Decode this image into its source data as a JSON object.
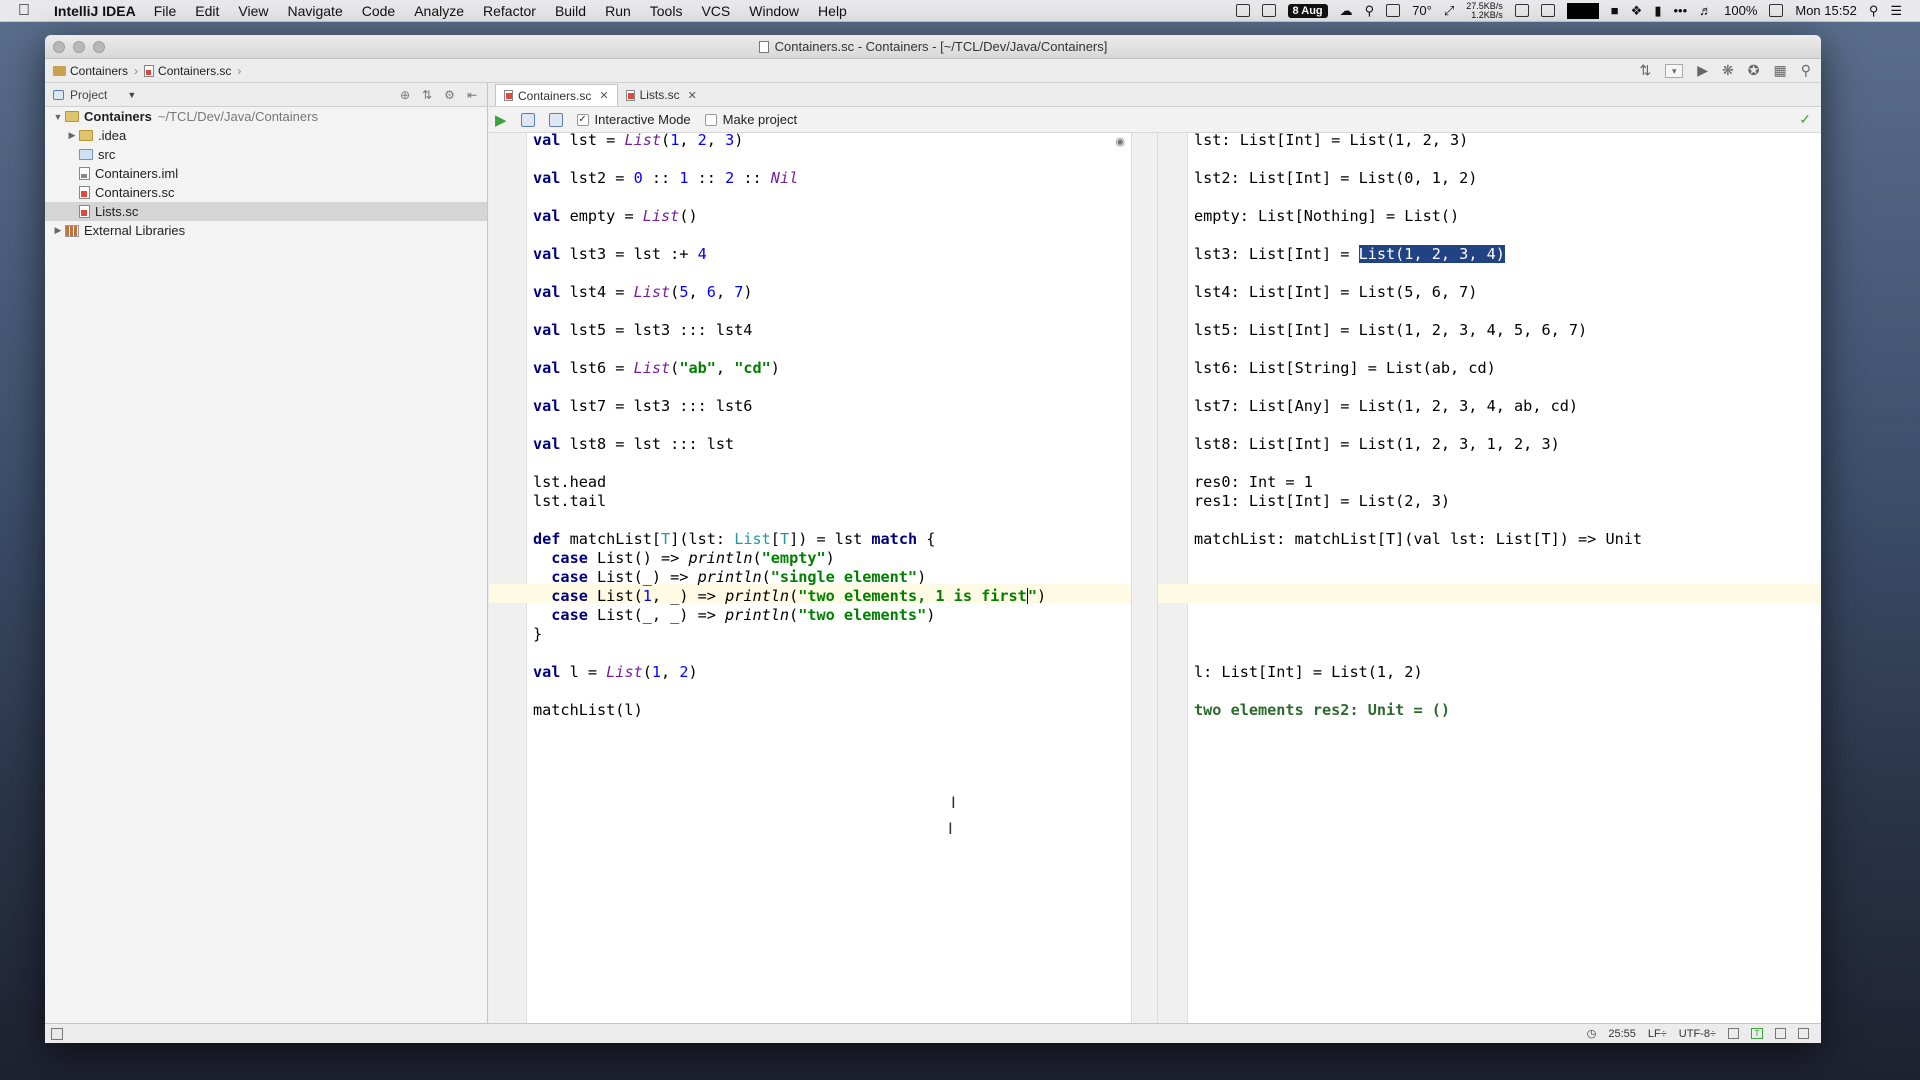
{
  "menubar": {
    "app_name": "IntelliJ IDEA",
    "menus": [
      "File",
      "Edit",
      "View",
      "Navigate",
      "Code",
      "Analyze",
      "Refactor",
      "Build",
      "Run",
      "Tools",
      "VCS",
      "Window",
      "Help"
    ],
    "date_badge": "8 Aug",
    "temperature": "70°",
    "net_up": "27.5KB/s",
    "net_down": "1.2KB/s",
    "battery": "100%",
    "clock": "Mon 15:52"
  },
  "window": {
    "title": "Containers.sc - Containers - [~/TCL/Dev/Java/Containers]"
  },
  "breadcrumb": {
    "project": "Containers",
    "file": "Containers.sc"
  },
  "project_pane": {
    "header": "Project",
    "tree": {
      "root_name": "Containers",
      "root_path": "~/TCL/Dev/Java/Containers",
      "items": [
        ".idea",
        "src",
        "Containers.iml",
        "Containers.sc",
        "Lists.sc"
      ],
      "external": "External Libraries"
    }
  },
  "tabs": [
    {
      "label": "Containers.sc",
      "active": true
    },
    {
      "label": "Lists.sc",
      "active": false
    }
  ],
  "worksheet_toolbar": {
    "interactive_mode": "Interactive Mode",
    "make_project": "Make project"
  },
  "code": {
    "l1_val": "val",
    "l1_name": " lst = ",
    "l1_ty": "List",
    "l1_args_open": "(",
    "l1_n1": "1",
    "l1_sep1": ", ",
    "l1_n2": "2",
    "l1_sep2": ", ",
    "l1_n3": "3",
    "l1_close": ")",
    "l2_val": "val",
    "l2_rest_a": " lst2 = ",
    "l2_n0": "0",
    "l2_op1": " :: ",
    "l2_n1": "1",
    "l2_op2": " :: ",
    "l2_n2": "2",
    "l2_op3": " :: ",
    "l2_nil": "Nil",
    "l3_val": "val",
    "l3_rest": " empty = ",
    "l3_ty": "List",
    "l3_close": "()",
    "l4_val": "val",
    "l4_rest": " lst3 = lst :+ ",
    "l4_n": "4",
    "l5_val": "val",
    "l5_rest": " lst4 = ",
    "l5_ty": "List",
    "l5_open": "(",
    "l5_n1": "5",
    "l5_s1": ", ",
    "l5_n2": "6",
    "l5_s2": ", ",
    "l5_n3": "7",
    "l5_close": ")",
    "l6_val": "val",
    "l6_rest": " lst5 = lst3 ::: lst4",
    "l7_val": "val",
    "l7_rest": " lst6 = ",
    "l7_ty": "List",
    "l7_open": "(",
    "l7_s1": "\"ab\"",
    "l7_sep": ", ",
    "l7_s2": "\"cd\"",
    "l7_close": ")",
    "l8_val": "val",
    "l8_rest": " lst7 = lst3 ::: lst6",
    "l9_val": "val",
    "l9_rest": " lst8 = lst ::: lst",
    "l10": "lst.head",
    "l11": "lst.tail",
    "l12_def": "def",
    "l12_a": " matchList[",
    "l12_t1": "T",
    "l12_b": "](lst: ",
    "l12_ty": "List",
    "l12_c": "[",
    "l12_t2": "T",
    "l12_d": "]) = lst ",
    "l12_match": "match",
    "l12_e": " {",
    "l13_case": "  case",
    "l13_a": " List() => ",
    "l13_fn": "println",
    "l13_open": "(",
    "l13_str": "\"empty\"",
    "l13_close": ")",
    "l14_case": "  case",
    "l14_a": " List(_) => ",
    "l14_fn": "println",
    "l14_open": "(",
    "l14_str": "\"single element\"",
    "l14_close": ")",
    "l15_case": "  case",
    "l15_a": " List(",
    "l15_n": "1",
    "l15_b": ", _) => ",
    "l15_fn": "println",
    "l15_open": "(",
    "l15_str_a": "\"two elements, 1 is first",
    "l15_str_b": "\"",
    "l15_close": ")",
    "l16_case": "  case",
    "l16_a": " List(_, _) => ",
    "l16_fn": "println",
    "l16_open": "(",
    "l16_str": "\"two elements\"",
    "l16_close": ")",
    "l17": "}",
    "l18_val": "val",
    "l18_rest": " l = ",
    "l18_ty": "List",
    "l18_open": "(",
    "l18_n1": "1",
    "l18_s": ", ",
    "l18_n2": "2",
    "l18_close": ")",
    "l19": "matchList(l)"
  },
  "output": {
    "o1": "lst: List[Int] = List(1, 2, 3)",
    "o2": "lst2: List[Int] = List(0, 1, 2)",
    "o3": "empty: List[Nothing] = List()",
    "o4_a": "lst3: List[Int] = ",
    "o4_sel": "List(1, 2, 3, 4)",
    "o5": "lst4: List[Int] = List(5, 6, 7)",
    "o6": "lst5: List[Int] = List(1, 2, 3, 4, 5, 6, 7)",
    "o7": "lst6: List[String] = List(ab, cd)",
    "o8": "lst7: List[Any] = List(1, 2, 3, 4, ab, cd)",
    "o9": "lst8: List[Int] = List(1, 2, 3, 1, 2, 3)",
    "o10": "res0: Int = 1",
    "o11": "res1: List[Int] = List(2, 3)",
    "o12": "matchList: matchList[T](val lst: List[T]) => Unit",
    "o13": "l: List[Int] = List(1, 2)",
    "o14": "two elements res2: Unit = ()"
  },
  "statusbar": {
    "position": "25:55",
    "line_sep": "LF÷",
    "encoding": "UTF-8÷"
  },
  "colors": {
    "keyword": "#000080",
    "type": "#7a1ea1",
    "number": "#0000ff",
    "string": "#008000",
    "selection": "#214283",
    "current_line": "#fffae3"
  }
}
